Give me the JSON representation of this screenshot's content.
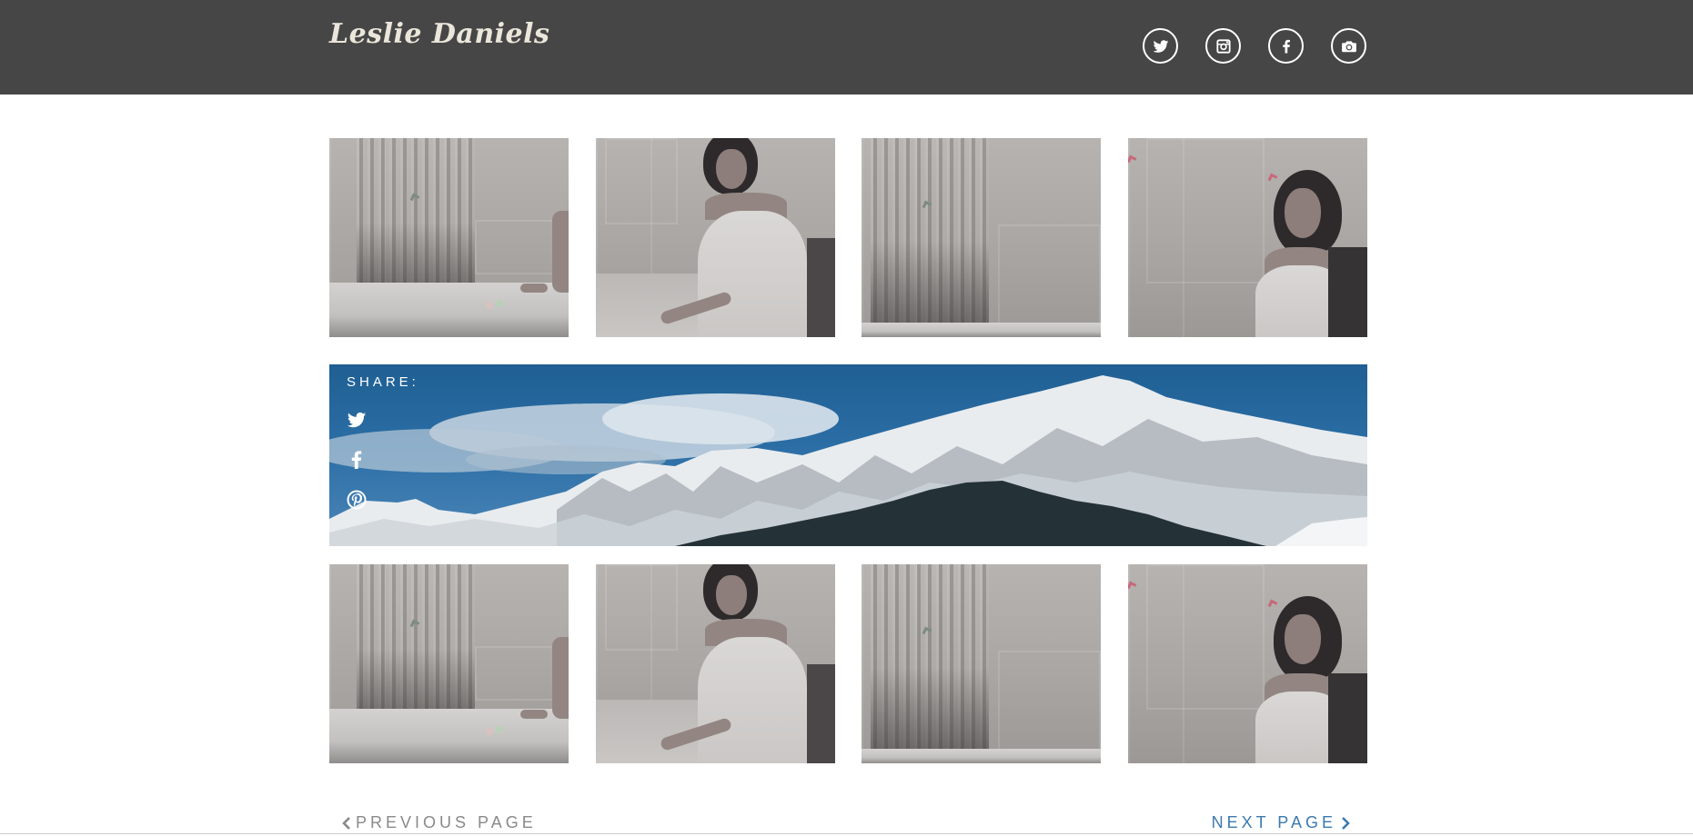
{
  "header": {
    "brand": "Leslie Daniels",
    "social": [
      {
        "icon": "twitter-icon"
      },
      {
        "icon": "instagram-icon"
      },
      {
        "icon": "facebook-icon"
      },
      {
        "icon": "camera-icon"
      }
    ]
  },
  "share": {
    "label": "SHARE:",
    "links": [
      {
        "icon": "twitter-icon"
      },
      {
        "icon": "facebook-icon"
      },
      {
        "icon": "pinterest-icon"
      }
    ]
  },
  "pagination": {
    "previous_label": "PREVIOUS PAGE",
    "next_label": "NEXT PAGE"
  },
  "colors": {
    "header_bg": "#464646",
    "brand_text": "#ebe6da",
    "next_link": "#3c7aae",
    "previous_link": "#8a8a8a",
    "banner_sky": "#2b6ea5"
  }
}
